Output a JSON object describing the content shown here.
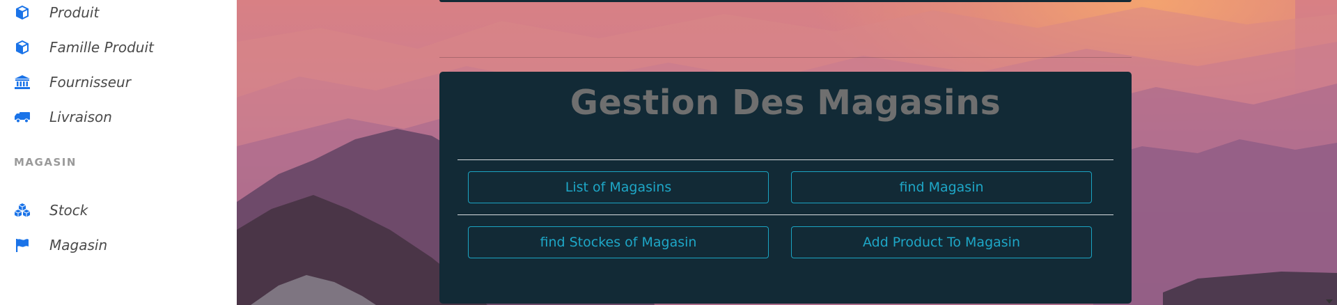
{
  "sidebar": {
    "items_top": [
      {
        "label": "Produit",
        "icon": "cube-icon"
      },
      {
        "label": "Famille Produit",
        "icon": "cube-icon"
      },
      {
        "label": "Fournisseur",
        "icon": "bank-icon"
      },
      {
        "label": "Livraison",
        "icon": "truck-icon"
      }
    ],
    "section_heading": "MAGASIN",
    "items_bottom": [
      {
        "label": "Stock",
        "icon": "cubes-icon"
      },
      {
        "label": "Magasin",
        "icon": "flag-icon"
      }
    ],
    "icon_color": "#1a73e8"
  },
  "card": {
    "title": "Gestion Des Magasins",
    "buttons": {
      "list": "List of Magasins",
      "find": "find Magasin",
      "find_stocks": "find Stockes of Magasin",
      "add_product": "Add Product To Magasin"
    },
    "button_color": "#1ea7c7",
    "background": "#122a36"
  }
}
